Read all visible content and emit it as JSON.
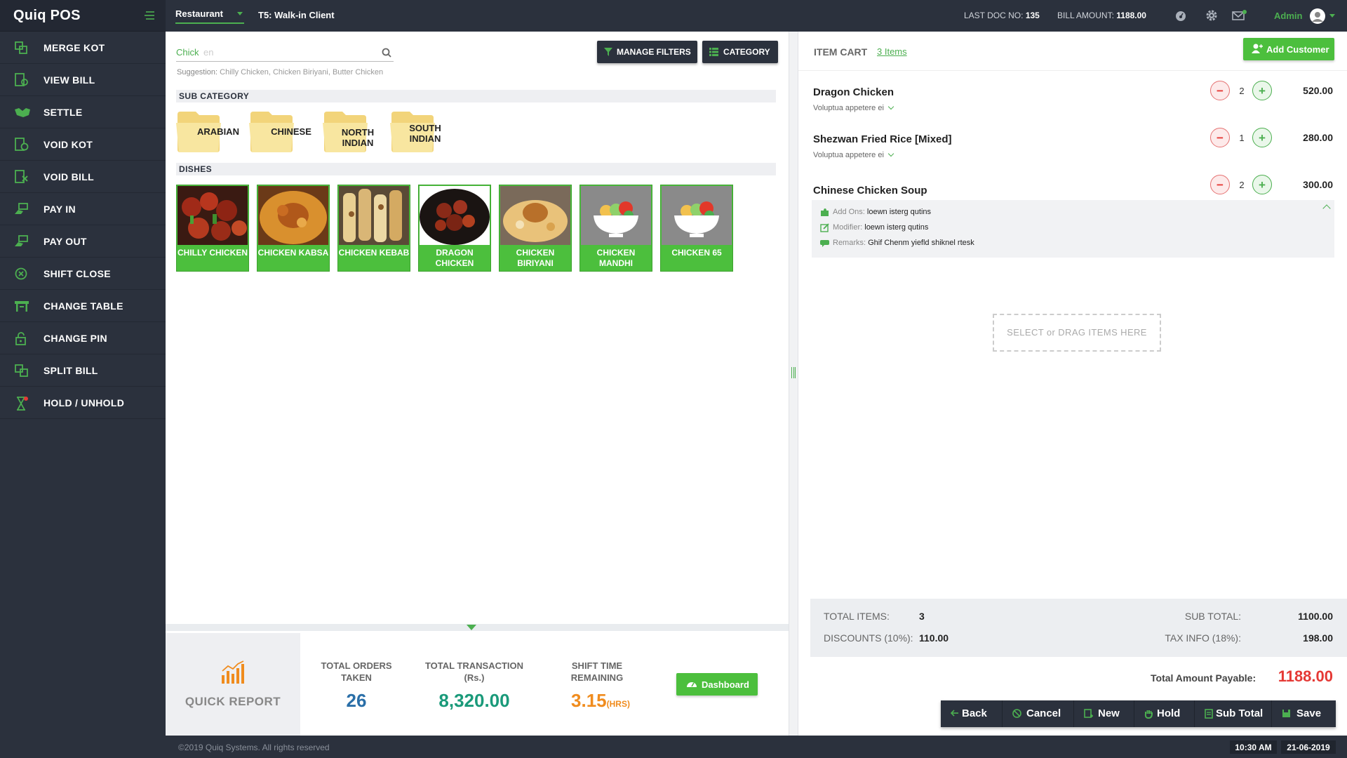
{
  "app": {
    "name": "Quiq POS"
  },
  "topbar": {
    "outlet": "Restaurant",
    "client": "T5: Walk-in Client",
    "last_doc_label": "LAST DOC NO:",
    "last_doc_value": "135",
    "bill_amount_label": "BILL AMOUNT:",
    "bill_amount_value": "1188.00",
    "user": "Admin"
  },
  "sidebar": {
    "items": [
      {
        "label": "MERGE KOT",
        "icon": "merge-icon"
      },
      {
        "label": "VIEW BILL",
        "icon": "view-bill-icon"
      },
      {
        "label": "SETTLE",
        "icon": "handshake-icon"
      },
      {
        "label": "VOID KOT",
        "icon": "void-kot-icon"
      },
      {
        "label": "VOID BILL",
        "icon": "void-bill-icon"
      },
      {
        "label": "PAY IN",
        "icon": "pay-in-icon"
      },
      {
        "label": "PAY OUT",
        "icon": "pay-out-icon"
      },
      {
        "label": "SHIFT CLOSE",
        "icon": "shift-close-icon"
      },
      {
        "label": "CHANGE TABLE",
        "icon": "table-icon"
      },
      {
        "label": "CHANGE PIN",
        "icon": "lock-icon"
      },
      {
        "label": "SPLIT BILL",
        "icon": "split-bill-icon"
      },
      {
        "label": "HOLD / UNHOLD",
        "icon": "hourglass-icon"
      }
    ]
  },
  "search": {
    "typed": "Chick",
    "autocomplete": "en",
    "suggestion_label": "Suggestion:",
    "suggestion_text": "Chilly Chicken, Chicken Biriyani, Butter Chicken"
  },
  "buttons": {
    "manage_filters": "MANAGE FILTERS",
    "category": "CATEGORY"
  },
  "sub_category": {
    "title": "SUB CATEGORY",
    "items": [
      "ARABIAN",
      "CHINESE",
      "NORTH INDIAN",
      "SOUTH INDIAN"
    ]
  },
  "dishes": {
    "title": "DISHES",
    "items": [
      {
        "name": "CHILLY CHICKEN"
      },
      {
        "name": "CHICKEN KABSA"
      },
      {
        "name": "CHICKEN KEBAB"
      },
      {
        "name": "DRAGON CHICKEN"
      },
      {
        "name": "CHICKEN BIRIYANI"
      },
      {
        "name": "CHICKEN MANDHI"
      },
      {
        "name": "CHICKEN 65"
      }
    ]
  },
  "quick_report": {
    "title": "QUICK REPORT",
    "orders_label": "TOTAL ORDERS TAKEN",
    "orders_value": "26",
    "transaction_label": "TOTAL TRANSACTION (Rs.)",
    "transaction_value": "8,320.00",
    "shift_label": "SHIFT TIME REMAINING",
    "shift_value": "3.15",
    "shift_unit": "(HRS)",
    "dashboard_button": "Dashboard"
  },
  "cart": {
    "title": "ITEM CART",
    "count": "3 Items",
    "add_customer": "Add Customer",
    "items": [
      {
        "name": "Dragon Chicken",
        "sub": "Voluptua appetere ei",
        "qty": "2",
        "price": "520.00"
      },
      {
        "name": "Shezwan Fried Rice [Mixed]",
        "sub": "Voluptua appetere ei",
        "qty": "1",
        "price": "280.00"
      },
      {
        "name": "Chinese Chicken Soup",
        "qty": "2",
        "price": "300.00"
      }
    ],
    "details": {
      "addons_label": "Add Ons:",
      "addons_value": "loewn isterg qutins",
      "modifier_label": "Modifier:",
      "modifier_value": "loewn isterg qutins",
      "remarks_label": "Remarks:",
      "remarks_value": "Ghif Chenm yiefld shiknel rtesk"
    },
    "drop_zone": "SELECT or DRAG ITEMS HERE"
  },
  "totals": {
    "total_items_label": "TOTAL ITEMS:",
    "total_items_value": "3",
    "discounts_label": "DISCOUNTS (10%):",
    "discounts_value": "110.00",
    "sub_total_label": "SUB TOTAL:",
    "sub_total_value": "1100.00",
    "tax_label": "TAX INFO (18%):",
    "tax_value": "198.00",
    "payable_label": "Total Amount Payable:",
    "payable_value": "1188.00"
  },
  "actions": {
    "back": "Back",
    "cancel": "Cancel",
    "new": "New",
    "hold": "Hold",
    "sub_total": "Sub Total",
    "save": "Save"
  },
  "footer": {
    "copyright": "©2019 Quiq Systems. All rights reserved",
    "time": "10:30 AM",
    "date": "21-06-2019"
  },
  "colors": {
    "accent": "#4caf50",
    "dark": "#2b313d",
    "danger": "#e53935",
    "orange": "#f08c1e",
    "blue": "#2a6fa8",
    "teal": "#1a9a7a"
  }
}
